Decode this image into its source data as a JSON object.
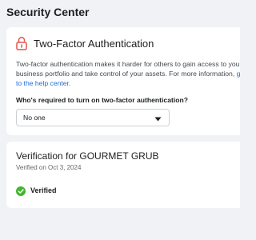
{
  "page": {
    "title": "Security Center"
  },
  "two_factor": {
    "title": "Two-Factor Authentication",
    "description": "Two-factor authentication makes it harder for others to gain access to your business portfolio and take control of your assets. For more information, ",
    "help_link": "go to the help center.",
    "question": "Who's required to turn on two-factor authentication?",
    "selected_option": "No one",
    "icon": "lock-icon",
    "accent_color": "#e4544a"
  },
  "verification": {
    "title": "Verification for GOURMET GRUB",
    "date": "Verified on Oct 3, 2024",
    "status": "Verified",
    "icon": "check-circle-icon",
    "status_color": "#42b72a"
  }
}
